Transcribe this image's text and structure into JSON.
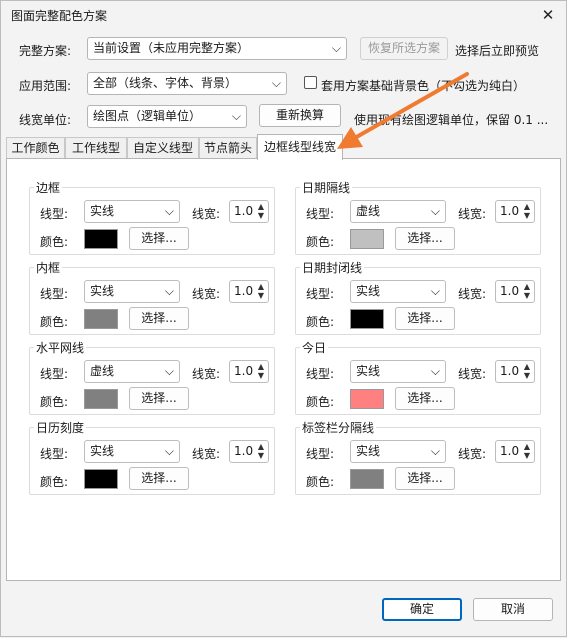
{
  "window": {
    "title": "图面完整配色方案",
    "close_glyph": "✕"
  },
  "top": {
    "scheme_label": "完整方案:",
    "scheme_value": "当前设置（未应用完整方案）",
    "restore_button": "恢复所选方案",
    "preview_text": "选择后立即预览",
    "range_label": "应用范围:",
    "range_value": "全部（线条、字体、背景）",
    "bg_checkbox_label": "套用方案基础背景色（不勾选为纯白）",
    "bg_checkbox_checked": false,
    "unit_label": "线宽单位:",
    "unit_value": "绘图点（逻辑单位）",
    "recalc_button": "重新换算",
    "unit_hint": "使用现有绘图逻辑单位，保留 0.1 ..."
  },
  "tabs": [
    "工作颜色",
    "工作线型",
    "自定义线型",
    "节点箭头",
    "边框线型线宽"
  ],
  "active_tab": 4,
  "field_labels": {
    "line_type": "线型:",
    "line_width": "线宽:",
    "color": "颜色:",
    "choose_button": "选择..."
  },
  "groups": [
    {
      "title": "边框",
      "line_type": "实线",
      "line_width": "1.0",
      "color": "#000000"
    },
    {
      "title": "日期隔线",
      "line_type": "虚线",
      "line_width": "1.0",
      "color": "#c0c0c0"
    },
    {
      "title": "内框",
      "line_type": "实线",
      "line_width": "1.0",
      "color": "#808080"
    },
    {
      "title": "日期封闭线",
      "line_type": "实线",
      "line_width": "1.0",
      "color": "#000000"
    },
    {
      "title": "水平网线",
      "line_type": "虚线",
      "line_width": "1.0",
      "color": "#808080"
    },
    {
      "title": "今日",
      "line_type": "实线",
      "line_width": "1.0",
      "color": "#ff8080"
    },
    {
      "title": "日历刻度",
      "line_type": "实线",
      "line_width": "1.0",
      "color": "#000000"
    },
    {
      "title": "标签栏分隔线",
      "line_type": "实线",
      "line_width": "1.0",
      "color": "#808080"
    }
  ],
  "footer": {
    "ok_button": "确定",
    "cancel_button": "取消"
  },
  "colors": {
    "accent": "#0067c0",
    "annotation_arrow": "#f07a30"
  }
}
